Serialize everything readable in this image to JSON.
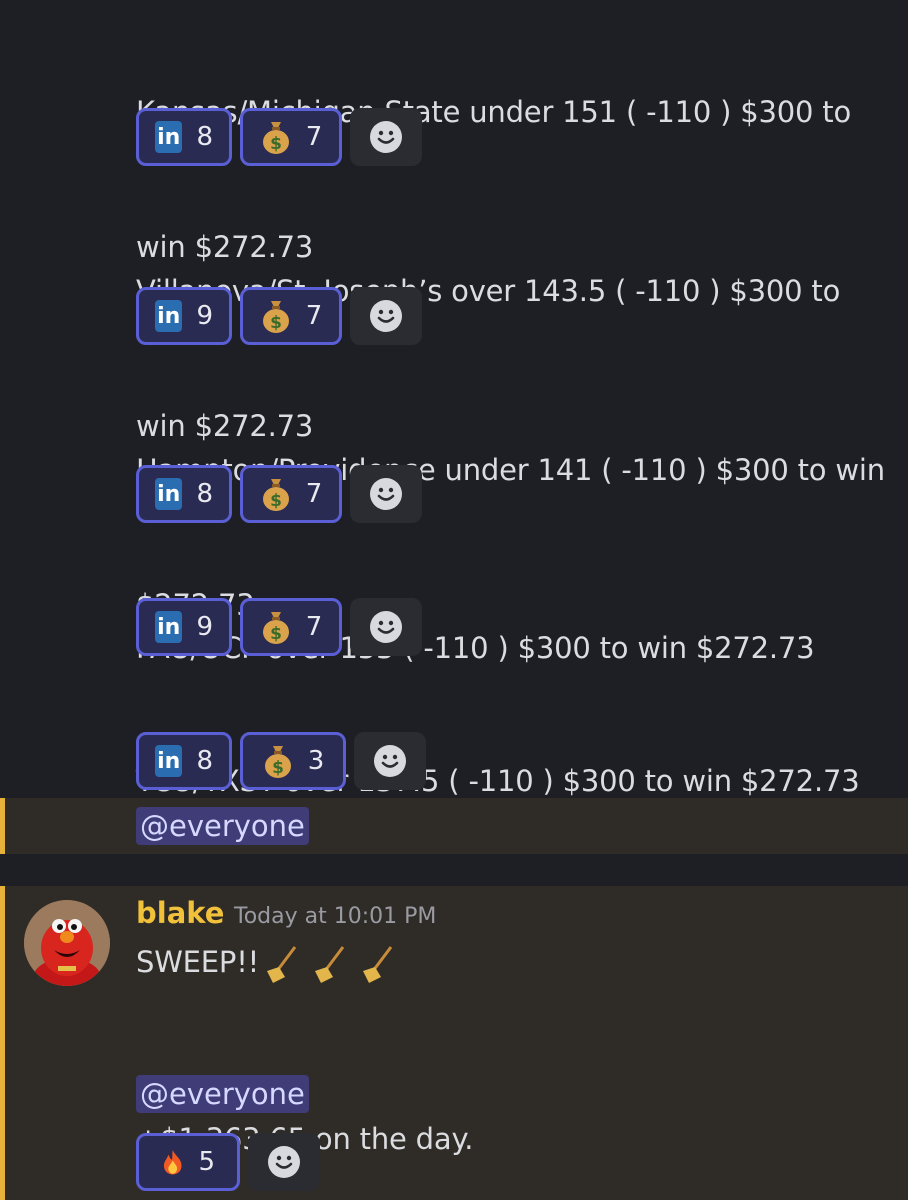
{
  "messages": [
    {
      "line1": "Kansas/Michigan State under 151 ( -110 ) $300 to",
      "line2": "win $272.73",
      "linkedin": "8",
      "moneybag": "7"
    },
    {
      "line1": "Villanova/St. Joseph’s over 143.5 ( -110 ) $300 to",
      "line2": "win $272.73",
      "linkedin": "9",
      "moneybag": "7"
    },
    {
      "line1": "Hampton/Providence under 141 ( -110 ) $300 to win",
      "line2": "$272.73",
      "linkedin": "8",
      "moneybag": "7"
    },
    {
      "line1": "FAU/UCF over 153 ( -110 ) $300 to win $272.73",
      "linkedin": "9",
      "moneybag": "7"
    },
    {
      "line1": "TCU/TXST over 137.5 ( -110 ) $300 to win $272.73",
      "linkedin": "8",
      "moneybag": "3"
    }
  ],
  "mention_everyone": "@everyone",
  "post": {
    "username": "blake",
    "timestamp": "Today at 10:01 PM",
    "line1": "SWEEP!!",
    "line2": "+$1,363.65 on the day.",
    "mention": "@everyone",
    "fire_count": "5"
  },
  "icons": {
    "linkedin": "linkedin-icon",
    "moneybag": "money-bag-icon",
    "broom": "broom-icon",
    "fire": "fire-icon",
    "add_reaction": "add-reaction-icon"
  },
  "colors": {
    "background": "#1e1f24",
    "mention_highlight": "#2f2b26",
    "mention_bar": "#e6b23a",
    "reaction_border": "#5b5fd6",
    "username": "#f2c13b"
  }
}
